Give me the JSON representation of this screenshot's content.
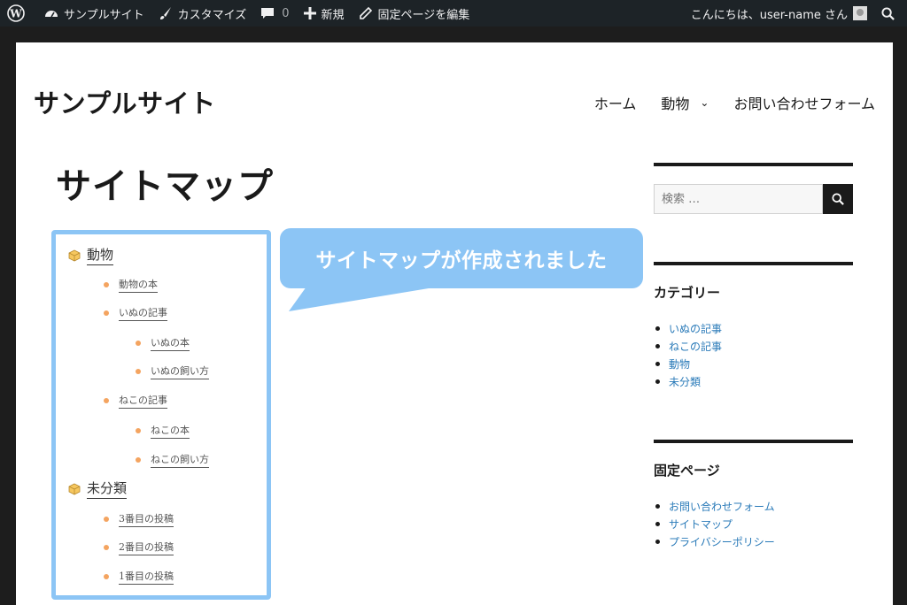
{
  "adminbar": {
    "site_name": "サンプルサイト",
    "customize": "カスタマイズ",
    "comments_count": "0",
    "new": "新規",
    "edit_page": "固定ページを編集",
    "greeting": "こんにちは、user-name さん"
  },
  "site": {
    "title": "サンプルサイト",
    "nav": [
      "ホーム",
      "動物",
      "お問い合わせフォーム"
    ]
  },
  "page": {
    "title": "サイトマップ"
  },
  "sitemap": {
    "cat1": "動物",
    "cat1_posts": [
      "動物の本",
      "いぬの記事",
      "いぬの本",
      "いぬの飼い方",
      "ねこの記事",
      "ねこの本",
      "ねこの飼い方"
    ],
    "cat2": "未分類",
    "cat2_posts": [
      "3番目の投稿",
      "2番目の投稿",
      "1番目の投稿"
    ]
  },
  "callout": {
    "text": "サイトマップが作成されました"
  },
  "sidebar": {
    "search_placeholder": "検索 …",
    "categories_title": "カテゴリー",
    "categories": [
      "いぬの記事",
      "ねこの記事",
      "動物",
      "未分類"
    ],
    "pages_title": "固定ページ",
    "pages": [
      "お問い合わせフォーム",
      "サイトマップ",
      "プライバシーポリシー"
    ]
  },
  "colors": {
    "adminbar": "#1d2327",
    "callout": "#8cc5f5",
    "link": "#2b7bb9",
    "bullet": "#f4a460"
  }
}
